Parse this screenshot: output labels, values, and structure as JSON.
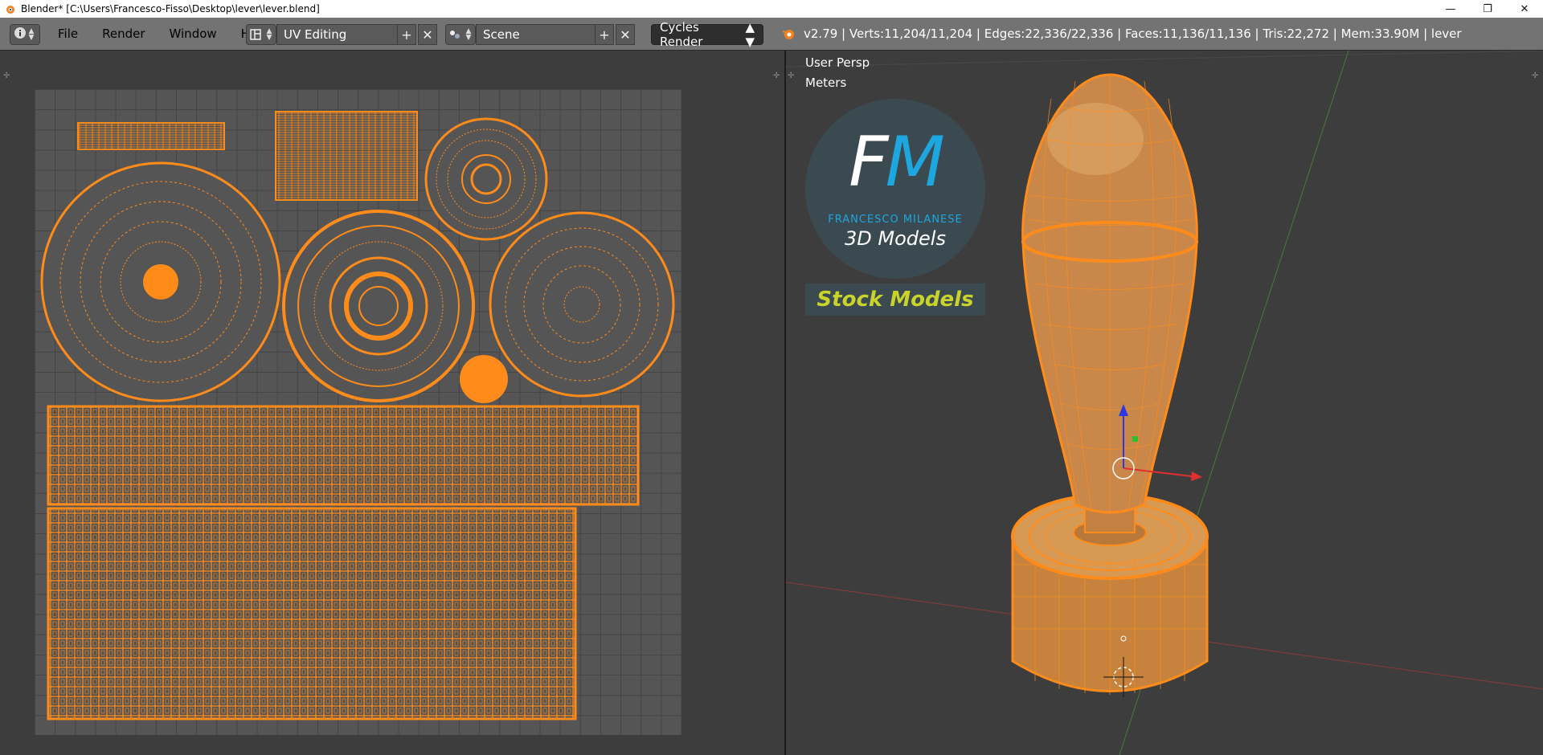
{
  "window": {
    "title": "Blender* [C:\\Users\\Francesco-Fisso\\Desktop\\lever\\lever.blend]",
    "minimize": "—",
    "restore": "❐",
    "close": "✕"
  },
  "menu": [
    "File",
    "Render",
    "Window",
    "Help"
  ],
  "screen_layout": {
    "value": "UV Editing"
  },
  "scene": {
    "value": "Scene"
  },
  "render_engine": {
    "value": "Cycles Render"
  },
  "stats": "v2.79 | Verts:11,204/11,204 | Edges:22,336/22,336 | Faces:11,136/11,136 | Tris:22,272 | Mem:33.90M | lever",
  "viewport": {
    "view_label": "User Persp",
    "units_label": "Meters"
  },
  "logo": {
    "letters": "FM",
    "name": "FRANCESCO MILANESE",
    "tagline": "3D Models",
    "badge": "Stock Models"
  },
  "colors": {
    "accent": "#ff8c1a",
    "header_bg": "#737373",
    "panel_bg": "#3d3d3d"
  }
}
